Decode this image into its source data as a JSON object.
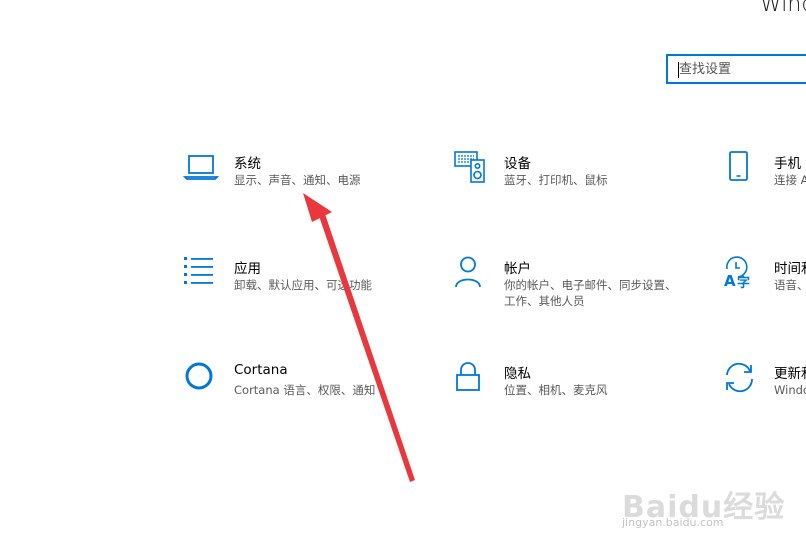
{
  "window": {
    "title": "Windo"
  },
  "search": {
    "placeholder": "查找设置"
  },
  "tiles": [
    {
      "title": "系统",
      "desc": "显示、声音、通知、电源",
      "icon": "laptop-icon"
    },
    {
      "title": "设备",
      "desc": "蓝牙、打印机、鼠标",
      "icon": "keyboard-speaker-icon"
    },
    {
      "title": "手机",
      "desc": "连接 A",
      "icon": "phone-icon"
    },
    {
      "title": "应用",
      "desc": "卸载、默认应用、可选功能",
      "icon": "apps-list-icon"
    },
    {
      "title": "帐户",
      "desc": "你的帐户、电子邮件、同步设置、工作、其他人员",
      "icon": "person-icon"
    },
    {
      "title": "时间和",
      "desc": "语音、",
      "icon": "time-language-icon"
    },
    {
      "title": "Cortana",
      "desc": "Cortana 语言、权限、通知",
      "icon": "cortana-ring-icon"
    },
    {
      "title": "隐私",
      "desc": "位置、相机、麦克风",
      "icon": "lock-icon"
    },
    {
      "title": "更新和",
      "desc": "Windo",
      "icon": "update-sync-icon"
    }
  ],
  "watermark": {
    "brand": "Baidu经验",
    "site": "jingyan.baidu.com"
  },
  "colors": {
    "accent": "#0078d7",
    "annotation_arrow": "#e8383d"
  }
}
